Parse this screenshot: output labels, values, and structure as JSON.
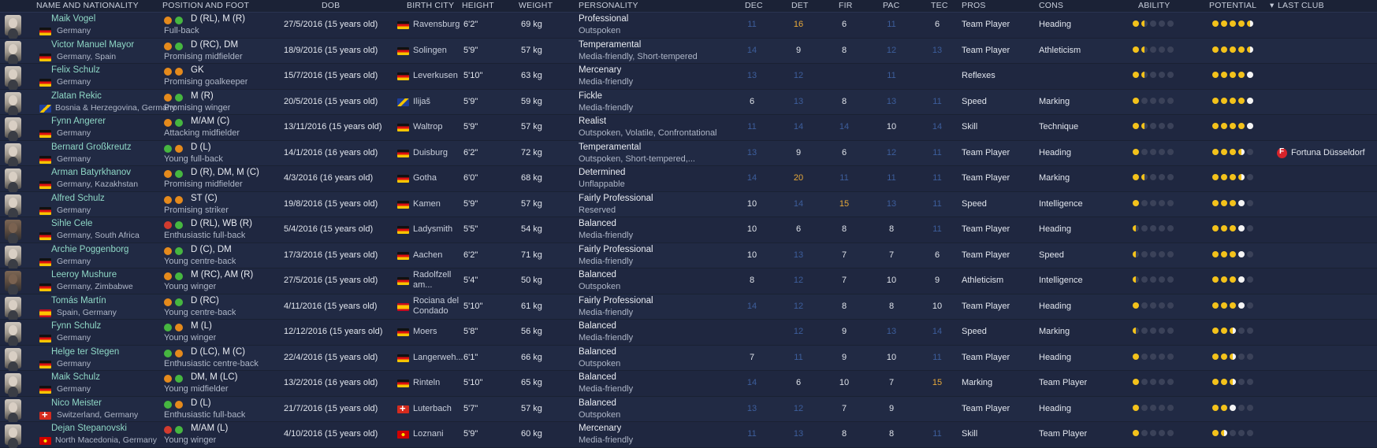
{
  "columns": {
    "name": "NAME AND NATIONALITY",
    "position": "POSITION AND FOOT",
    "dob": "DOB",
    "birth_city": "BIRTH CITY",
    "height": "HEIGHT",
    "weight": "WEIGHT",
    "personality": "PERSONALITY",
    "dec": "DEC",
    "det": "DET",
    "fir": "FIR",
    "pac": "PAC",
    "tec": "TEC",
    "pros": "PROS",
    "cons": "CONS",
    "ability": "ABILITY",
    "potential": "POTENTIAL",
    "last_club": "LAST CLUB"
  },
  "sort_icon": "sort-desc-arrow-icon",
  "colors": {
    "background": "#1b2236",
    "name": "#8fd8c6",
    "high_attr": "#e7a93a",
    "low_attr": "#3d5e9c",
    "star": "#f3c21b"
  },
  "players": [
    {
      "name": "Maik Vogel",
      "nationality": "Germany",
      "flags": [
        "de"
      ],
      "position": "D (RL), M (R)",
      "foot": [
        "o",
        "g"
      ],
      "role": "Full-back",
      "dob": "27/5/2016 (15 years old)",
      "birth_city": "Ravensburg",
      "height": "6'2\"",
      "weight": "69 kg",
      "personality": "Professional",
      "media": "Outspoken",
      "dec": "11",
      "det": "16",
      "fir": "6",
      "pac": "11",
      "tec": "6",
      "pros": "Team Player",
      "cons": "Heading",
      "ability": 1.5,
      "potential": 4.5,
      "last_club": ""
    },
    {
      "name": "Victor Manuel Mayor",
      "nationality": "Germany, Spain",
      "flags": [
        "de"
      ],
      "position": "D (RC), DM",
      "foot": [
        "o",
        "g"
      ],
      "role": "Promising midfielder",
      "dob": "18/9/2016 (15 years old)",
      "birth_city": "Solingen",
      "height": "5'9\"",
      "weight": "57 kg",
      "personality": "Temperamental",
      "media": "Media-friendly, Short-tempered",
      "dec": "14",
      "det": "9",
      "fir": "8",
      "pac": "12",
      "tec": "13",
      "pros": "Team Player",
      "cons": "Athleticism",
      "ability": 1.5,
      "potential": 4.5,
      "last_club": ""
    },
    {
      "name": "Felix Schulz",
      "nationality": "Germany",
      "flags": [
        "de"
      ],
      "position": "GK",
      "foot": [
        "o",
        "o"
      ],
      "role": "Promising goalkeeper",
      "dob": "15/7/2016 (15 years old)",
      "birth_city": "Leverkusen",
      "height": "5'10\"",
      "weight": "63 kg",
      "personality": "Mercenary",
      "media": "Media-friendly",
      "dec": "13",
      "det": "12",
      "fir": "",
      "pac": "11",
      "tec": "",
      "pros": "Reflexes",
      "cons": "",
      "ability": 1.5,
      "potential": 4.0,
      "last_club": ""
    },
    {
      "name": "Zlatan Rekic",
      "nationality": "Bosnia & Herzegovina, Germany",
      "flags": [
        "ba"
      ],
      "position": "M (R)",
      "foot": [
        "o",
        "g"
      ],
      "role": "Promising winger",
      "dob": "20/5/2016 (15 years old)",
      "birth_city": "Ilijaš",
      "height": "5'9\"",
      "weight": "59 kg",
      "personality": "Fickle",
      "media": "Media-friendly",
      "dec": "6",
      "det": "13",
      "fir": "8",
      "pac": "13",
      "tec": "11",
      "pros": "Speed",
      "cons": "Marking",
      "ability": 1.0,
      "potential": 4.0,
      "last_club": ""
    },
    {
      "name": "Fynn Angerer",
      "nationality": "Germany",
      "flags": [
        "de"
      ],
      "position": "M/AM (C)",
      "foot": [
        "o",
        "g"
      ],
      "role": "Attacking midfielder",
      "dob": "13/11/2016 (15 years old)",
      "birth_city": "Waltrop",
      "height": "5'9\"",
      "weight": "57 kg",
      "personality": "Realist",
      "media": "Outspoken, Volatile, Confrontational",
      "dec": "11",
      "det": "14",
      "fir": "14",
      "pac": "10",
      "tec": "14",
      "pros": "Skill",
      "cons": "Technique",
      "ability": 1.5,
      "potential": 4.0,
      "last_club": ""
    },
    {
      "name": "Bernard Großkreutz",
      "nationality": "Germany",
      "flags": [
        "de"
      ],
      "position": "D (L)",
      "foot": [
        "g",
        "o"
      ],
      "role": "Young full-back",
      "dob": "14/1/2016 (16 years old)",
      "birth_city": "Duisburg",
      "height": "6'2\"",
      "weight": "72 kg",
      "personality": "Temperamental",
      "media": "Outspoken, Short-tempered,...",
      "dec": "13",
      "det": "9",
      "fir": "6",
      "pac": "12",
      "tec": "11",
      "pros": "Team Player",
      "cons": "Heading",
      "ability": 1.0,
      "potential": 3.5,
      "last_club": "Fortuna Düsseldorf"
    },
    {
      "name": "Arman Batyrkhanov",
      "nationality": "Germany, Kazakhstan",
      "flags": [
        "de"
      ],
      "position": "D (R), DM, M (C)",
      "foot": [
        "o",
        "g"
      ],
      "role": "Promising midfielder",
      "dob": "4/3/2016 (16 years old)",
      "birth_city": "Gotha",
      "height": "6'0\"",
      "weight": "68 kg",
      "personality": "Determined",
      "media": "Unflappable",
      "dec": "14",
      "det": "20",
      "fir": "11",
      "pac": "11",
      "tec": "11",
      "pros": "Team Player",
      "cons": "Marking",
      "ability": 1.5,
      "potential": 3.5,
      "last_club": ""
    },
    {
      "name": "Alfred Schulz",
      "nationality": "Germany",
      "flags": [
        "de"
      ],
      "position": "ST (C)",
      "foot": [
        "o",
        "o"
      ],
      "role": "Promising striker",
      "dob": "19/8/2016 (15 years old)",
      "birth_city": "Kamen",
      "height": "5'9\"",
      "weight": "57 kg",
      "personality": "Fairly Professional",
      "media": "Reserved",
      "dec": "10",
      "det": "14",
      "fir": "15",
      "pac": "13",
      "tec": "11",
      "pros": "Speed",
      "cons": "Intelligence",
      "ability": 1.0,
      "potential": 3.0,
      "last_club": ""
    },
    {
      "name": "Sihle Cele",
      "nationality": "Germany, South Africa",
      "flags": [
        "de"
      ],
      "position": "D (RL), WB (R)",
      "foot": [
        "r",
        "g"
      ],
      "role": "Enthusiastic full-back",
      "dob": "5/4/2016 (15 years old)",
      "birth_city": "Ladysmith",
      "height": "5'5\"",
      "weight": "54 kg",
      "personality": "Balanced",
      "media": "Media-friendly",
      "dec": "10",
      "det": "6",
      "fir": "8",
      "pac": "8",
      "tec": "11",
      "pros": "Team Player",
      "cons": "Heading",
      "ability": 0.5,
      "potential": 3.0,
      "last_club": ""
    },
    {
      "name": "Archie Poggenborg",
      "nationality": "Germany",
      "flags": [
        "de"
      ],
      "position": "D (C), DM",
      "foot": [
        "o",
        "g"
      ],
      "role": "Young centre-back",
      "dob": "17/3/2016 (15 years old)",
      "birth_city": "Aachen",
      "height": "6'2\"",
      "weight": "71 kg",
      "personality": "Fairly Professional",
      "media": "Media-friendly",
      "dec": "10",
      "det": "13",
      "fir": "7",
      "pac": "7",
      "tec": "6",
      "pros": "Team Player",
      "cons": "Speed",
      "ability": 0.5,
      "potential": 3.0,
      "last_club": ""
    },
    {
      "name": "Leeroy Mushure",
      "nationality": "Germany, Zimbabwe",
      "flags": [
        "de"
      ],
      "position": "M (RC), AM (R)",
      "foot": [
        "o",
        "g"
      ],
      "role": "Young winger",
      "dob": "27/5/2016 (15 years old)",
      "birth_city": "Radolfzell am...",
      "height": "5'4\"",
      "weight": "50 kg",
      "personality": "Balanced",
      "media": "Outspoken",
      "dec": "8",
      "det": "12",
      "fir": "7",
      "pac": "10",
      "tec": "9",
      "pros": "Athleticism",
      "cons": "Intelligence",
      "ability": 0.5,
      "potential": 3.0,
      "last_club": ""
    },
    {
      "name": "Tomás Martín",
      "nationality": "Spain, Germany",
      "flags": [
        "es"
      ],
      "position": "D (RC)",
      "foot": [
        "o",
        "g"
      ],
      "role": "Young centre-back",
      "dob": "4/11/2016 (15 years old)",
      "birth_city": "Rociana del Condado",
      "height": "5'10\"",
      "weight": "61 kg",
      "personality": "Fairly Professional",
      "media": "Media-friendly",
      "dec": "14",
      "det": "12",
      "fir": "8",
      "pac": "8",
      "tec": "10",
      "pros": "Team Player",
      "cons": "Heading",
      "ability": 1.0,
      "potential": 3.0,
      "last_club": ""
    },
    {
      "name": "Fynn Schulz",
      "nationality": "Germany",
      "flags": [
        "de"
      ],
      "position": "M (L)",
      "foot": [
        "g",
        "o"
      ],
      "role": "Young winger",
      "dob": "12/12/2016 (15 years old)",
      "birth_city": "Moers",
      "height": "5'8\"",
      "weight": "56 kg",
      "personality": "Balanced",
      "media": "Media-friendly",
      "dec": "",
      "det": "12",
      "fir": "9",
      "pac": "13",
      "tec": "14",
      "pros": "Speed",
      "cons": "Marking",
      "ability": 0.5,
      "potential": 2.5,
      "last_club": ""
    },
    {
      "name": "Helge ter Stegen",
      "nationality": "Germany",
      "flags": [
        "de"
      ],
      "position": "D (LC), M (C)",
      "foot": [
        "g",
        "o"
      ],
      "role": "Enthusiastic centre-back",
      "dob": "22/4/2016 (15 years old)",
      "birth_city": "Langerweh...",
      "height": "6'1\"",
      "weight": "66 kg",
      "personality": "Balanced",
      "media": "Outspoken",
      "dec": "7",
      "det": "11",
      "fir": "9",
      "pac": "10",
      "tec": "11",
      "pros": "Team Player",
      "cons": "Heading",
      "ability": 1.0,
      "potential": 2.5,
      "last_club": ""
    },
    {
      "name": "Maik Schulz",
      "nationality": "Germany",
      "flags": [
        "de"
      ],
      "position": "DM, M (LC)",
      "foot": [
        "o",
        "g"
      ],
      "role": "Young midfielder",
      "dob": "13/2/2016 (16 years old)",
      "birth_city": "Rinteln",
      "height": "5'10\"",
      "weight": "65 kg",
      "personality": "Balanced",
      "media": "Media-friendly",
      "dec": "14",
      "det": "6",
      "fir": "10",
      "pac": "7",
      "tec": "15",
      "pros": "Marking",
      "cons": "Team Player",
      "ability": 1.0,
      "potential": 2.5,
      "last_club": ""
    },
    {
      "name": "Nico Meister",
      "nationality": "Switzerland, Germany",
      "flags": [
        "ch"
      ],
      "position": "D (L)",
      "foot": [
        "g",
        "o"
      ],
      "role": "Enthusiastic full-back",
      "dob": "21/7/2016 (15 years old)",
      "birth_city": "Luterbach",
      "height": "5'7\"",
      "weight": "57 kg",
      "personality": "Balanced",
      "media": "Outspoken",
      "dec": "13",
      "det": "12",
      "fir": "7",
      "pac": "9",
      "tec": "",
      "pros": "Team Player",
      "cons": "Heading",
      "ability": 1.0,
      "potential": 2.0,
      "last_club": ""
    },
    {
      "name": "Dejan Stepanovski",
      "nationality": "North Macedonia, Germany",
      "flags": [
        "mk"
      ],
      "position": "M/AM (L)",
      "foot": [
        "r",
        "g"
      ],
      "role": "Young winger",
      "dob": "4/10/2016 (15 years old)",
      "birth_city": "Loznani",
      "height": "5'9\"",
      "weight": "60 kg",
      "personality": "Mercenary",
      "media": "Media-friendly",
      "dec": "11",
      "det": "13",
      "fir": "8",
      "pac": "8",
      "tec": "11",
      "pros": "Skill",
      "cons": "Team Player",
      "ability": 1.0,
      "potential": 1.5,
      "last_club": ""
    }
  ]
}
